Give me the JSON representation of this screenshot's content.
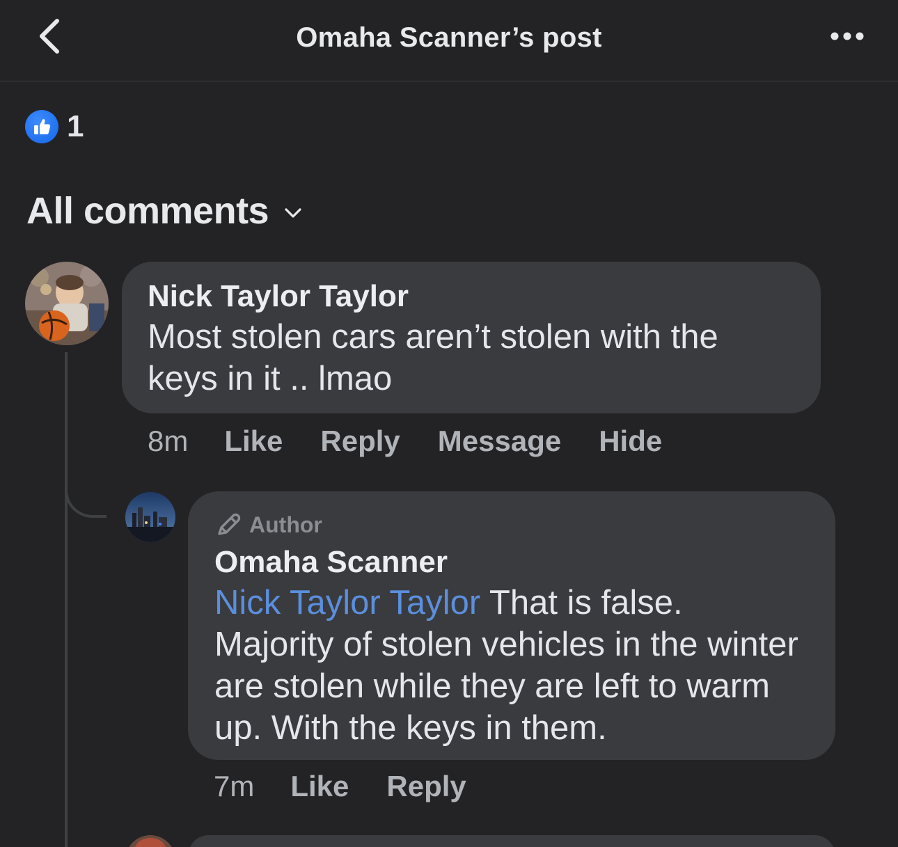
{
  "header": {
    "title": "Omaha Scanner’s post",
    "back_icon": "chevron-left-icon",
    "more_icon": "more-horizontal-icon"
  },
  "reactions": {
    "icon": "like-reaction-icon",
    "count": "1"
  },
  "comments_filter": {
    "label": "All comments",
    "icon": "chevron-down-icon"
  },
  "comments": [
    {
      "author": "Nick Taylor Taylor",
      "text": "Most stolen cars aren’t stolen with the keys in it .. lmao",
      "time": "8m",
      "actions": [
        "Like",
        "Reply",
        "Message",
        "Hide"
      ],
      "replies": [
        {
          "badge": "Author",
          "badge_icon": "pencil-icon",
          "author": "Omaha Scanner",
          "mention": "Nick Taylor Taylor",
          "text": "That is false. Majority of stolen vehicles in the winter are stolen while they are left to warm up. With the keys in them.",
          "time": "7m",
          "actions": [
            "Like",
            "Reply"
          ]
        }
      ]
    }
  ],
  "colors": {
    "background": "#232326",
    "bubble": "#3a3b3e",
    "mention": "#5b8fde",
    "like_blue": "#1877f2",
    "muted_text": "#b0b3b8"
  }
}
